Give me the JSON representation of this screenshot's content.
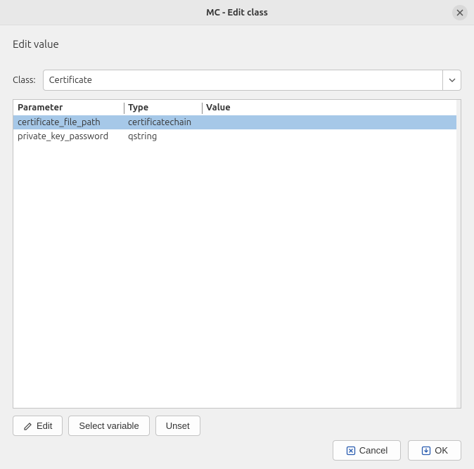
{
  "window": {
    "title": "MC - Edit class"
  },
  "section": {
    "title": "Edit value"
  },
  "class_field": {
    "label": "Class:",
    "value": "Certificate"
  },
  "table": {
    "headers": {
      "parameter": "Parameter",
      "type": "Type",
      "value": "Value"
    },
    "rows": [
      {
        "parameter": "certificate_file_path",
        "type": "certificatechain",
        "value": "",
        "selected": true
      },
      {
        "parameter": "private_key_password",
        "type": "qstring",
        "value": "",
        "selected": false
      }
    ]
  },
  "buttons": {
    "edit": "Edit",
    "select_variable": "Select variable",
    "unset": "Unset",
    "cancel": "Cancel",
    "ok": "OK"
  }
}
